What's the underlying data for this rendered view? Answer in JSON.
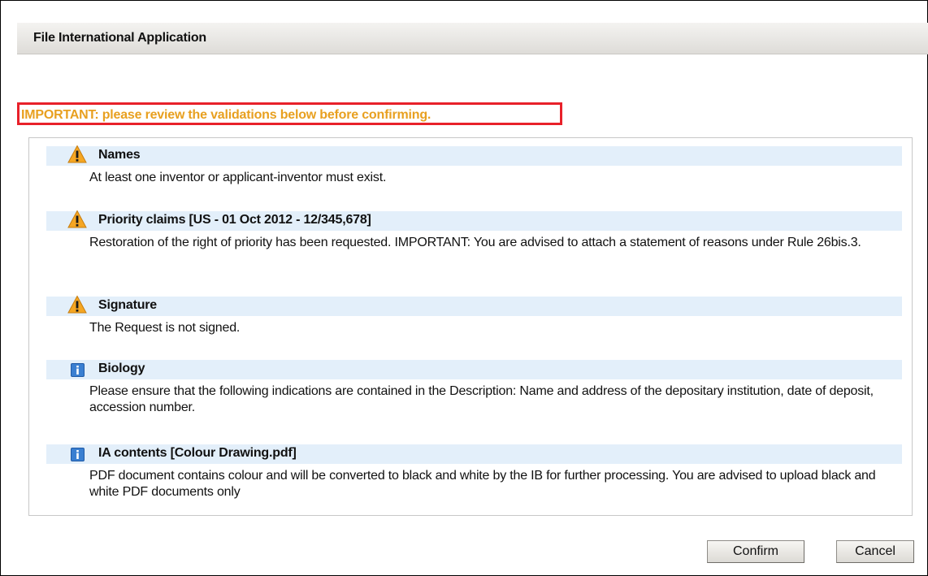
{
  "dialog": {
    "title": "File International Application"
  },
  "notice": {
    "text": "IMPORTANT: please review the validations below before confirming."
  },
  "validations": [
    {
      "icon": "warning-icon",
      "title": "Names",
      "description": "At least one inventor or applicant-inventor must exist."
    },
    {
      "icon": "warning-icon",
      "title": "Priority claims [US - 01 Oct 2012 - 12/345,678]",
      "description": "Restoration of the right of priority has been requested. IMPORTANT: You are advised to attach a statement of reasons under Rule 26bis.3."
    },
    {
      "icon": "warning-icon",
      "title": "Signature",
      "description": "The Request is not signed."
    },
    {
      "icon": "info-icon",
      "title": "Biology",
      "description": "Please ensure that the following indications are contained in the Description: Name and address of the depositary institution, date of deposit, accession number."
    },
    {
      "icon": "info-icon",
      "title": "IA contents [Colour Drawing.pdf]",
      "description": "PDF document contains colour and will be converted to black and white by the IB for further processing. You are advised to upload black and white PDF documents only"
    }
  ],
  "buttons": {
    "confirm_label": "Confirm",
    "cancel_label": "Cancel"
  },
  "colors": {
    "notice_text": "#e8a020",
    "notice_border": "#e8212a",
    "item_header_bg": "#e3effa",
    "warning_icon": "#f5a623",
    "info_icon": "#3a7fd1"
  }
}
